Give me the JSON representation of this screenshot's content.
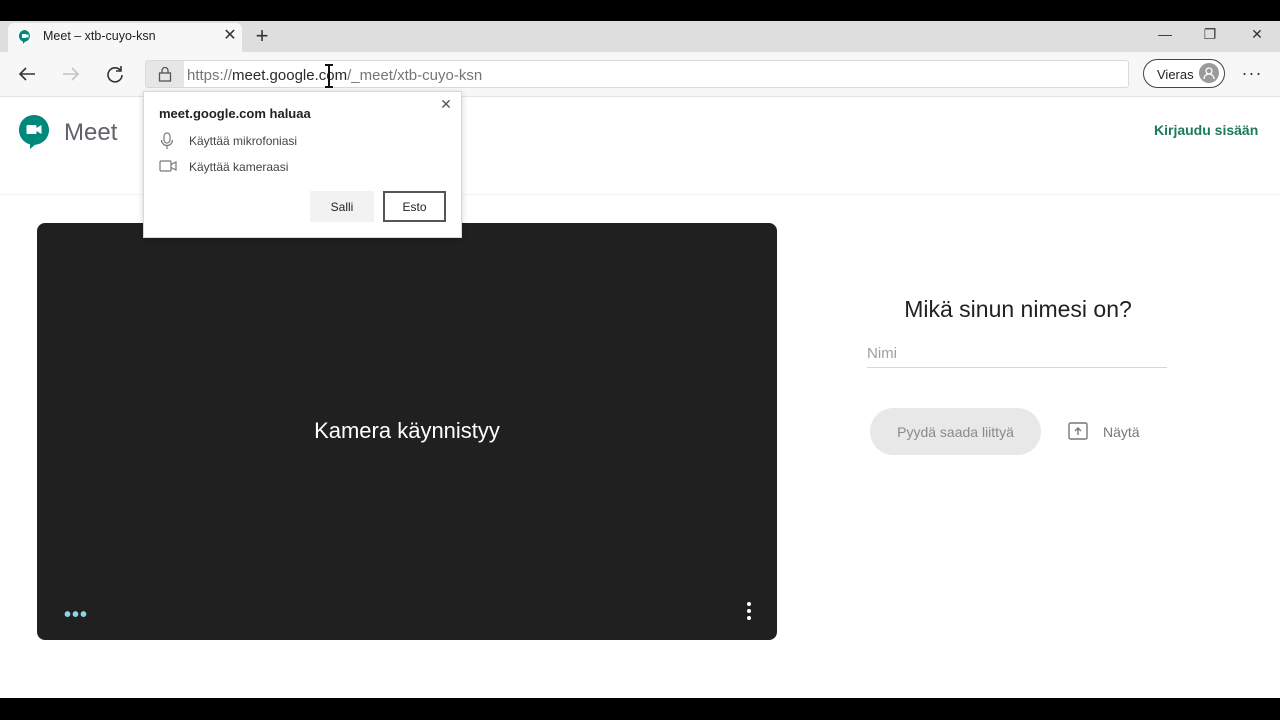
{
  "browser": {
    "tab": {
      "title": "Meet – xtb-cuyo-ksn",
      "close_glyph": "✕"
    },
    "new_tab_glyph": "+",
    "window_controls": {
      "minimize": "—",
      "restore": "❐",
      "close": "✕"
    },
    "address": {
      "scheme": "https://",
      "host": "meet.google.com",
      "path": "/_meet/xtb-cuyo-ksn"
    },
    "profile": {
      "label": "Vieras"
    },
    "menu_glyph": "···",
    "icons": {
      "back": "back-arrow-icon",
      "forward": "forward-arrow-icon",
      "reload": "reload-icon",
      "lock": "lock-icon",
      "avatar": "guest-avatar-icon"
    }
  },
  "permission_popup": {
    "title": "meet.google.com haluaa",
    "close_glyph": "✕",
    "permissions": [
      {
        "icon": "microphone-icon",
        "label": "Käyttää mikrofoniasi"
      },
      {
        "icon": "camera-icon",
        "label": "Käyttää kameraasi"
      }
    ],
    "allow_label": "Salli",
    "block_label": "Esto"
  },
  "meet": {
    "wordmark": "Meet",
    "sign_in": "Kirjaudu sisään",
    "video": {
      "status": "Kamera käynnistyy",
      "left_menu_glyph": "•••"
    },
    "join": {
      "question": "Mikä sinun nimesi on?",
      "name_placeholder": "Nimi",
      "name_value": "",
      "join_button": "Pyydä saada liittyä",
      "present_label": "Näytä"
    }
  },
  "colors": {
    "accent_green": "#1a7a5a",
    "meet_logo_teal": "#00897b",
    "video_bg": "#202020"
  }
}
